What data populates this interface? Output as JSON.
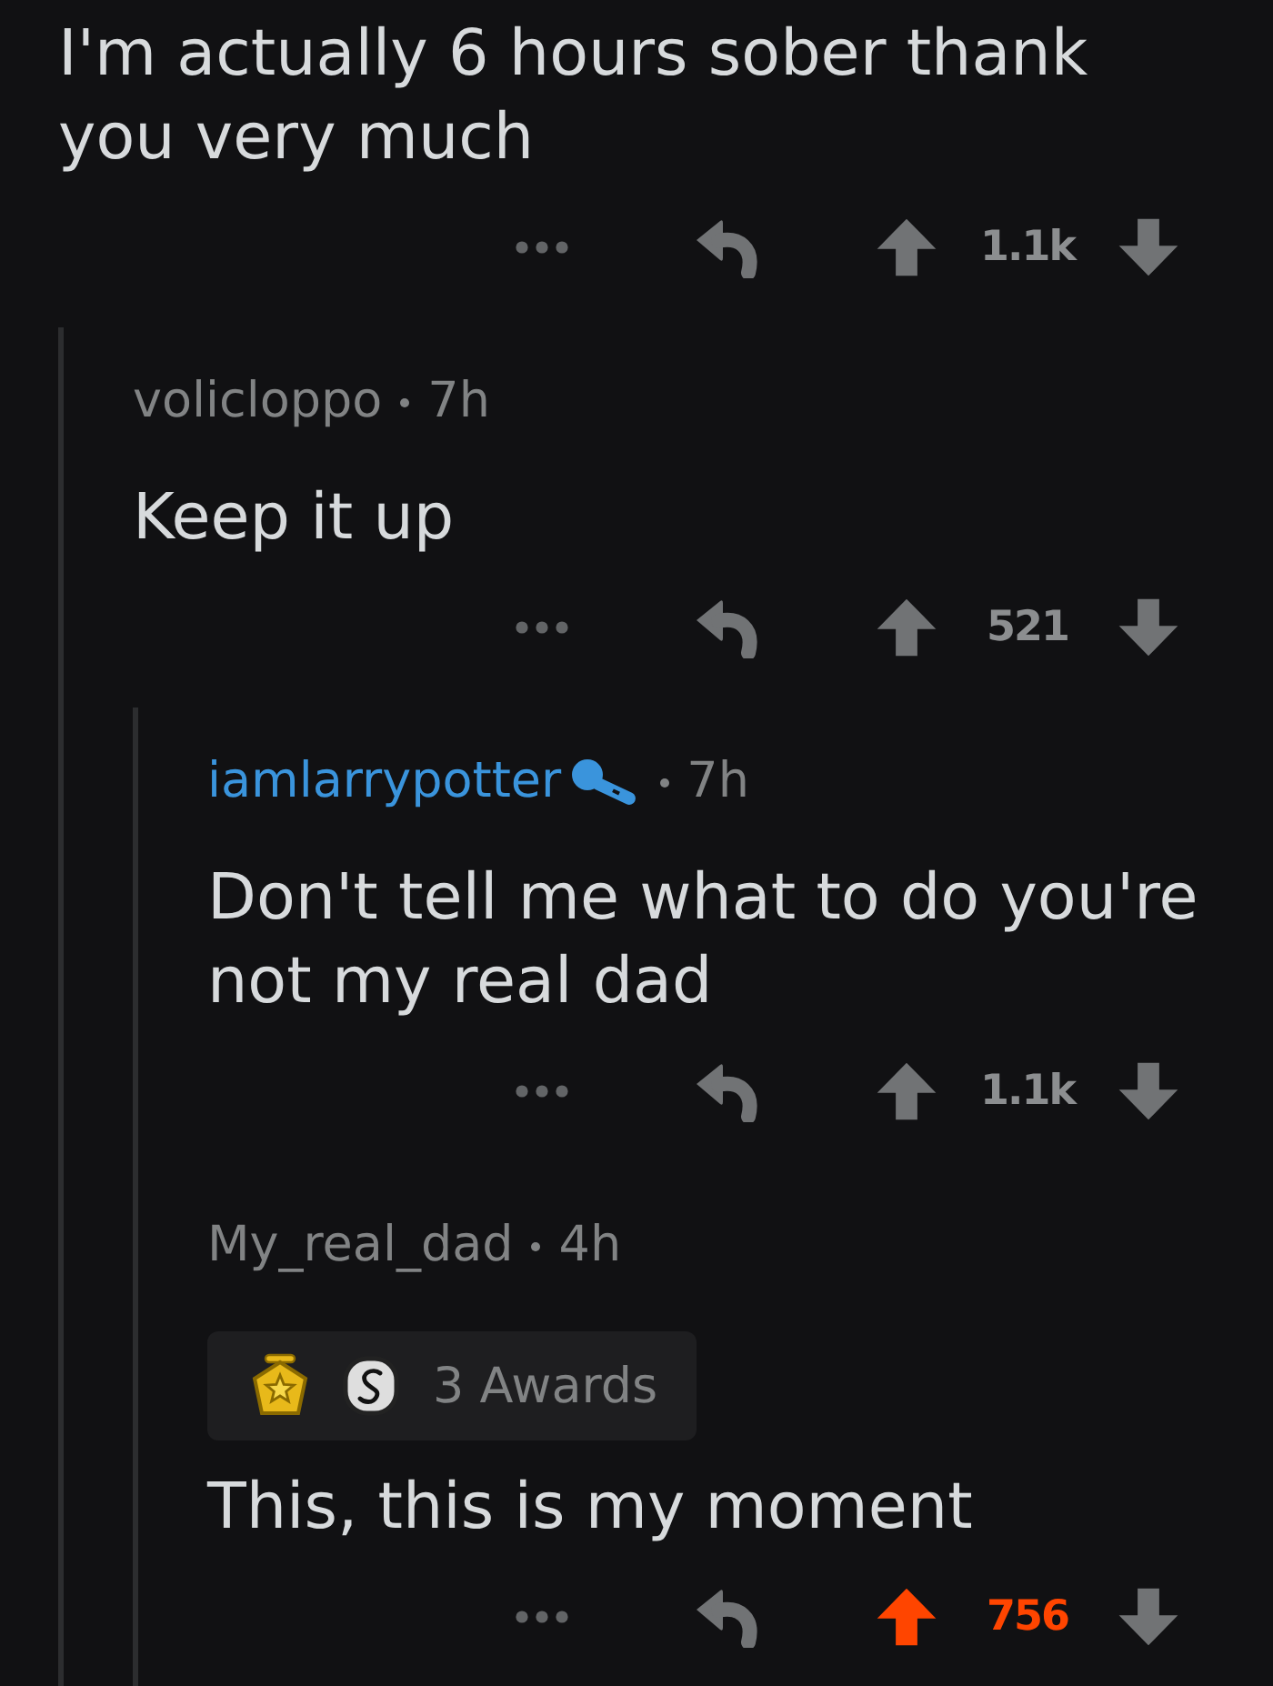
{
  "comment": {
    "body": "I'm actually 6 hours sober thank you very much",
    "score": "1.1k",
    "upvoted": false,
    "children": [
      {
        "author": "volicloppo",
        "time": "7h",
        "op": false,
        "has_badge_icon": false,
        "body": "Keep it up",
        "score": "521",
        "upvoted": false,
        "children": [
          {
            "author": "iamlarrypotter",
            "time": "7h",
            "op": true,
            "has_badge_icon": true,
            "body": "Don't tell me what to do you're not my real dad",
            "score": "1.1k",
            "upvoted": false
          },
          {
            "author": "My_real_dad",
            "time": "4h",
            "op": false,
            "has_badge_icon": false,
            "awards": {
              "icons": [
                {
                  "kind": "gold"
                },
                {
                  "kind": "silver"
                }
              ],
              "label": "3 Awards"
            },
            "body": "This, this is my moment",
            "score": "756",
            "upvoted": true
          }
        ]
      }
    ]
  }
}
